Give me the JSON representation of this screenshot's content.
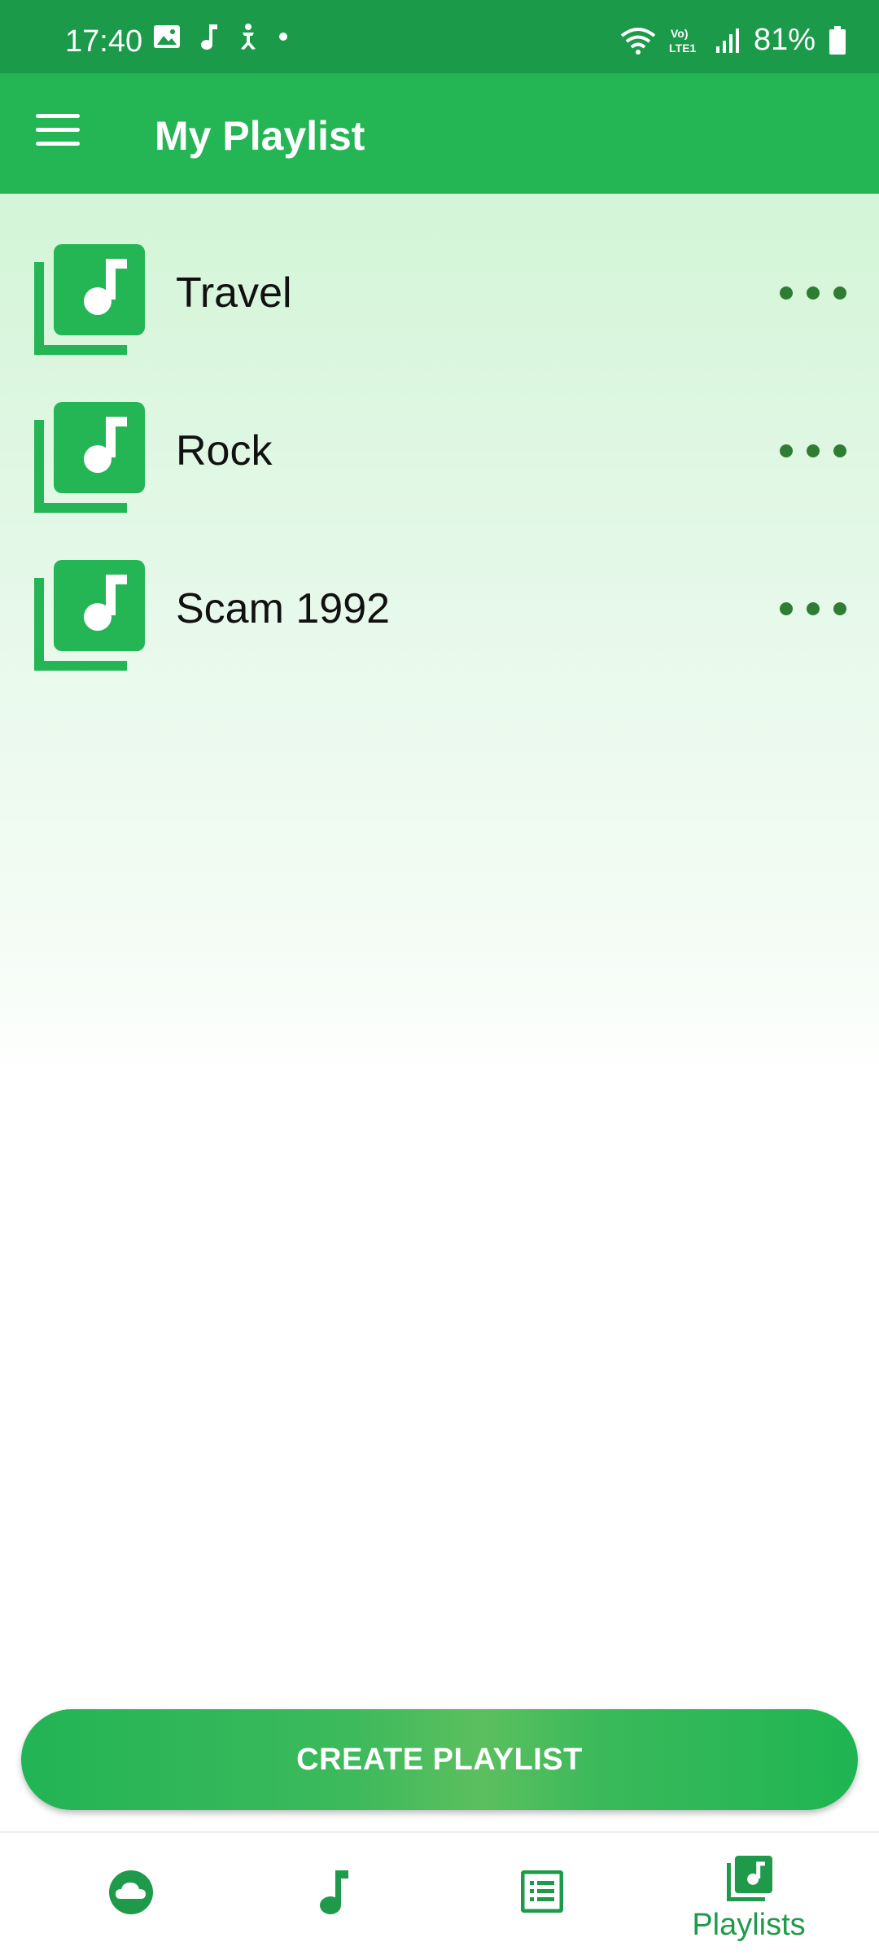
{
  "status_bar": {
    "time": "17:40",
    "battery": "81%",
    "left_icons": [
      "gallery-icon",
      "music-note-icon",
      "accessibility-icon",
      "dot-icon"
    ],
    "right_icons": [
      "wifi-icon",
      "volte-icon",
      "signal-icon",
      "battery-icon"
    ]
  },
  "app_bar": {
    "title": "My Playlist",
    "menu_icon": "menu-icon"
  },
  "playlists": [
    {
      "name": "Travel"
    },
    {
      "name": "Rock"
    },
    {
      "name": "Scam 1992"
    }
  ],
  "create_button": {
    "label": "CREATE PLAYLIST"
  },
  "bottom_nav": {
    "items": [
      {
        "icon": "cloud-icon",
        "label": ""
      },
      {
        "icon": "music-note-icon",
        "label": ""
      },
      {
        "icon": "list-icon",
        "label": ""
      },
      {
        "icon": "playlist-icon",
        "label": "Playlists"
      }
    ]
  },
  "colors": {
    "status_bar": "#1b9a4a",
    "app_bar": "#24b555",
    "accent": "#24b555",
    "more_dots": "#2e7d32",
    "nav_icon": "#1e9a4a"
  }
}
